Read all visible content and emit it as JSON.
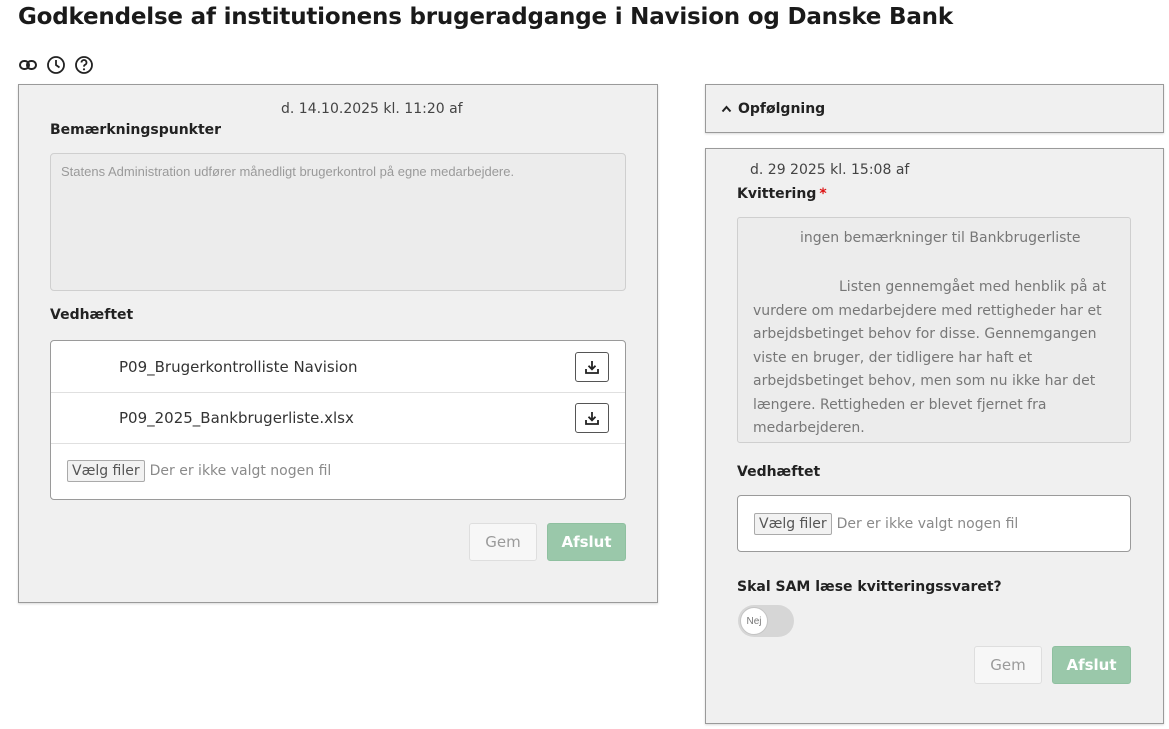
{
  "page": {
    "title": "Godkendelse af institutionens brugeradgange i Navision og Danske Bank",
    "icons": [
      "link-icon",
      "clock-icon",
      "help-icon"
    ]
  },
  "left_panel": {
    "timestamp": "d. 14.10.2025 kl. 11:20 af",
    "remarks_label": "Bemærkningspunkter",
    "remarks_placeholder": "Statens Administration udfører månedligt brugerkontrol på egne medarbejdere.",
    "attachments_label": "Vedhæftet",
    "attachments": [
      {
        "name": "P09_Brugerkontrolliste Navision"
      },
      {
        "name": "P09_2025_Bankbrugerliste.xlsx"
      }
    ],
    "file_button": "Vælg filer",
    "file_status": "Der er ikke valgt nogen fil",
    "save_label": "Gem",
    "finish_label": "Afslut"
  },
  "followup": {
    "header_label": "Opfølgning",
    "timestamp": "d. 29 2025 kl. 15:08 af",
    "receipt_label": "Kvittering",
    "required_mark": "*",
    "receipt_line1": "ingen bemærkninger til Bankbrugerliste",
    "receipt_para": "Listen gennemgået med henblik på at vurdere om medarbejdere med rettigheder har et arbejdsbetinget behov for disse. Gennemgangen viste en bruger, der tidligere har haft et arbejdsbetinget behov, men som nu ikke har det længere. Rettigheden er blevet fjernet fra medarbejderen.",
    "attachments_label": "Vedhæftet",
    "file_button": "Vælg filer",
    "file_status": "Der er ikke valgt nogen fil",
    "question_label": "Skal SAM læse kvitteringssvaret?",
    "toggle_value": "Nej",
    "save_label": "Gem",
    "finish_label": "Afslut"
  },
  "colors": {
    "primary_disabled": "#9ac8aa",
    "required": "#dd1111",
    "panel_bg": "#f0f0f0"
  }
}
